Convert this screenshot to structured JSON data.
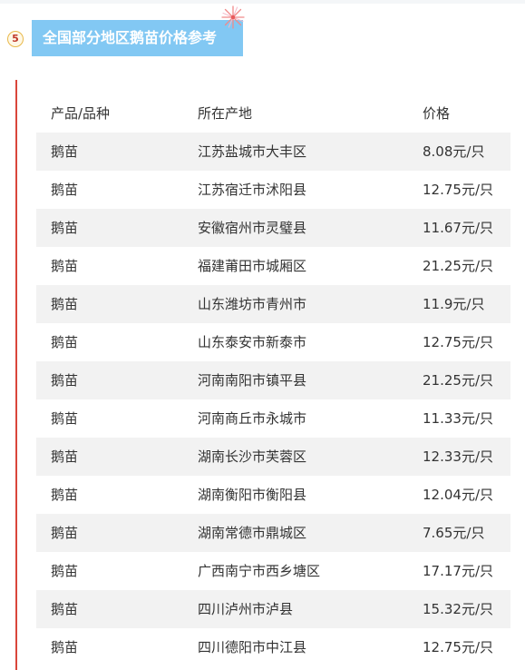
{
  "section": {
    "number": "5",
    "title": "全国部分地区鹅苗价格参考"
  },
  "table": {
    "headers": [
      "产品/品种",
      "所在产地",
      "价格"
    ],
    "rows": [
      [
        "鹅苗",
        "江苏盐城市大丰区",
        "8.08元/只"
      ],
      [
        "鹅苗",
        "江苏宿迁市沭阳县",
        "12.75元/只"
      ],
      [
        "鹅苗",
        "安徽宿州市灵璧县",
        "11.67元/只"
      ],
      [
        "鹅苗",
        "福建莆田市城厢区",
        "21.25元/只"
      ],
      [
        "鹅苗",
        "山东潍坊市青州市",
        "11.9元/只"
      ],
      [
        "鹅苗",
        "山东泰安市新泰市",
        "12.75元/只"
      ],
      [
        "鹅苗",
        "河南南阳市镇平县",
        "21.25元/只"
      ],
      [
        "鹅苗",
        "河南商丘市永城市",
        "11.33元/只"
      ],
      [
        "鹅苗",
        "湖南长沙市芙蓉区",
        "12.33元/只"
      ],
      [
        "鹅苗",
        "湖南衡阳市衡阳县",
        "12.04元/只"
      ],
      [
        "鹅苗",
        "湖南常德市鼎城区",
        "7.65元/只"
      ],
      [
        "鹅苗",
        "广西南宁市西乡塘区",
        "17.17元/只"
      ],
      [
        "鹅苗",
        "四川泸州市泸县",
        "15.32元/只"
      ],
      [
        "鹅苗",
        "四川德阳市中江县",
        "12.75元/只"
      ]
    ]
  },
  "colors": {
    "title_background": "#82c8f3",
    "accent_line": "#d9463b",
    "row_shade": "#f2f2f2"
  },
  "icons": {
    "title_decoration": "firework-icon"
  }
}
